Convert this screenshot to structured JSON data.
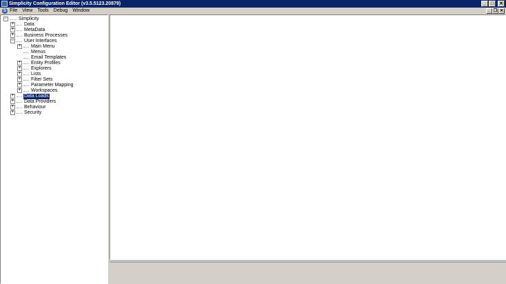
{
  "window": {
    "title": "Simplicity Configuration Editor (v3.5.5123.20879)",
    "controls": [
      "_",
      "□",
      "✕"
    ]
  },
  "menubar": {
    "app_icon_letter": "S",
    "items": [
      "File",
      "View",
      "Tools",
      "Debug",
      "Window"
    ],
    "mdi_controls": [
      "_",
      "❐",
      "✕"
    ]
  },
  "tree": {
    "root": "Simplicity",
    "nodes": [
      {
        "label": "Data",
        "expander": "+"
      },
      {
        "label": "MetaData",
        "expander": "+"
      },
      {
        "label": "Business Processes",
        "expander": "+"
      },
      {
        "label": "User Interfaces",
        "expander": "−"
      },
      {
        "label": "Main Menu",
        "expander": "+"
      },
      {
        "label": "Menus",
        "expander": ""
      },
      {
        "label": "Email Templates",
        "expander": ""
      },
      {
        "label": "Entity Profiles",
        "expander": "+"
      },
      {
        "label": "Explorers",
        "expander": "+"
      },
      {
        "label": "Lists",
        "expander": "+"
      },
      {
        "label": "Filter Sets",
        "expander": "+"
      },
      {
        "label": "Parameter Mapping",
        "expander": "+"
      },
      {
        "label": "Workspaces",
        "expander": "+"
      },
      {
        "label": "Data Loads",
        "expander": "+",
        "selected": true
      },
      {
        "label": "Data Providers",
        "expander": "+"
      },
      {
        "label": "Behaviour",
        "expander": "+"
      },
      {
        "label": "Security",
        "expander": "+"
      }
    ],
    "root_expander": "−"
  }
}
